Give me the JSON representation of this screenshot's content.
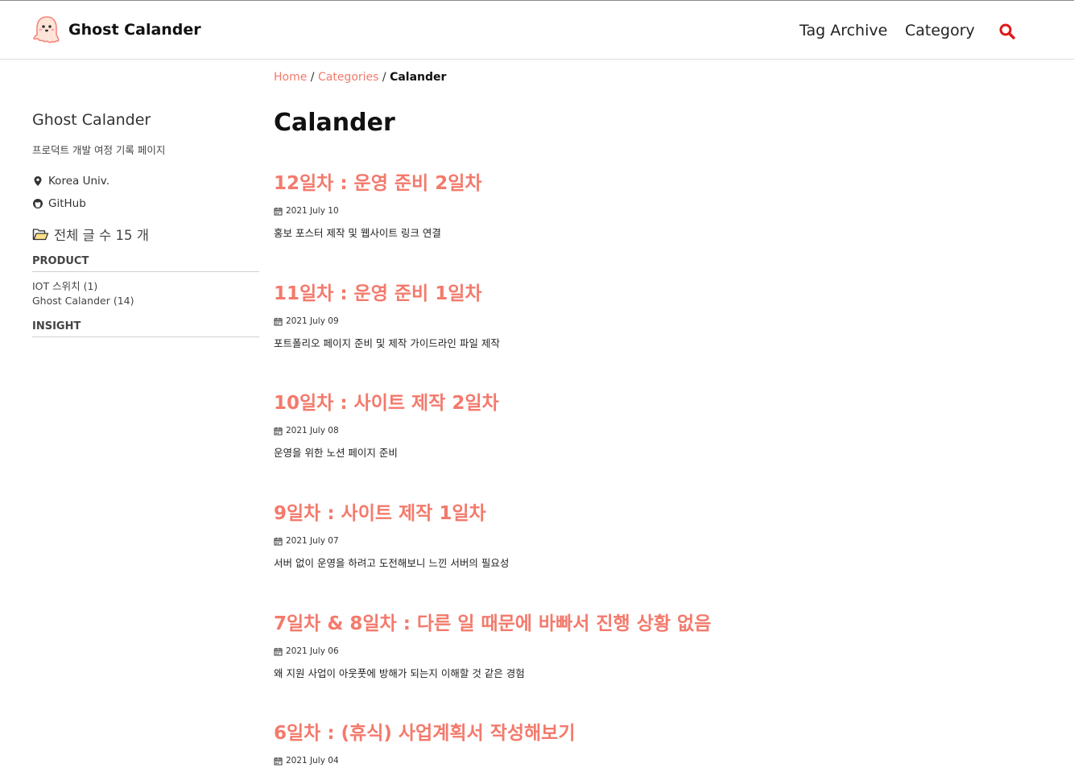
{
  "header": {
    "brand": "Ghost Calander",
    "nav": [
      "Tag Archive",
      "Category"
    ],
    "search_icon": "search-icon",
    "accent": "#e01a1a"
  },
  "sidebar": {
    "title": "Ghost Calander",
    "description": "프로덕트 개발 여정 기록 페이지",
    "location": "Korea Univ.",
    "github": "GitHub",
    "total": "전체 글 수 15 개",
    "categories": [
      {
        "name": "PRODUCT",
        "items": [
          "IOT 스위치 (1)",
          "Ghost Calander (14)"
        ]
      },
      {
        "name": "INSIGHT",
        "items": []
      }
    ]
  },
  "breadcrumb": {
    "home": "Home",
    "categories": "Categories",
    "current": "Calander"
  },
  "page_title": "Calander",
  "posts": [
    {
      "title": "12일차 : 운영 준비 2일차",
      "date": "2021 July 10",
      "desc": "홍보 포스터 제작 및 웹사이트 링크 연결"
    },
    {
      "title": "11일차 : 운영 준비 1일차",
      "date": "2021 July 09",
      "desc": "포트폴리오 페이지 준비 및 제작 가이드라인 파일 제작"
    },
    {
      "title": "10일차 : 사이트 제작 2일차",
      "date": "2021 July 08",
      "desc": "운영을 위한 노션 페이지 준비"
    },
    {
      "title": "9일차 : 사이트 제작 1일차",
      "date": "2021 July 07",
      "desc": "서버 없이 운영을 하려고 도전해보니 느낀 서버의 필요성"
    },
    {
      "title": "7일차 & 8일차 : 다른 일 때문에 바빠서 진행 상황 없음",
      "date": "2021 July 06",
      "desc": "왜 지원 사업이 아웃풋에 방해가 되는지 이해할 것 같은 경험"
    },
    {
      "title": "6일차 : (휴식) 사업계획서 작성해보기",
      "date": "2021 July 04",
      "desc": ""
    }
  ],
  "colors": {
    "link": "#f37a6c",
    "text": "#222222"
  }
}
